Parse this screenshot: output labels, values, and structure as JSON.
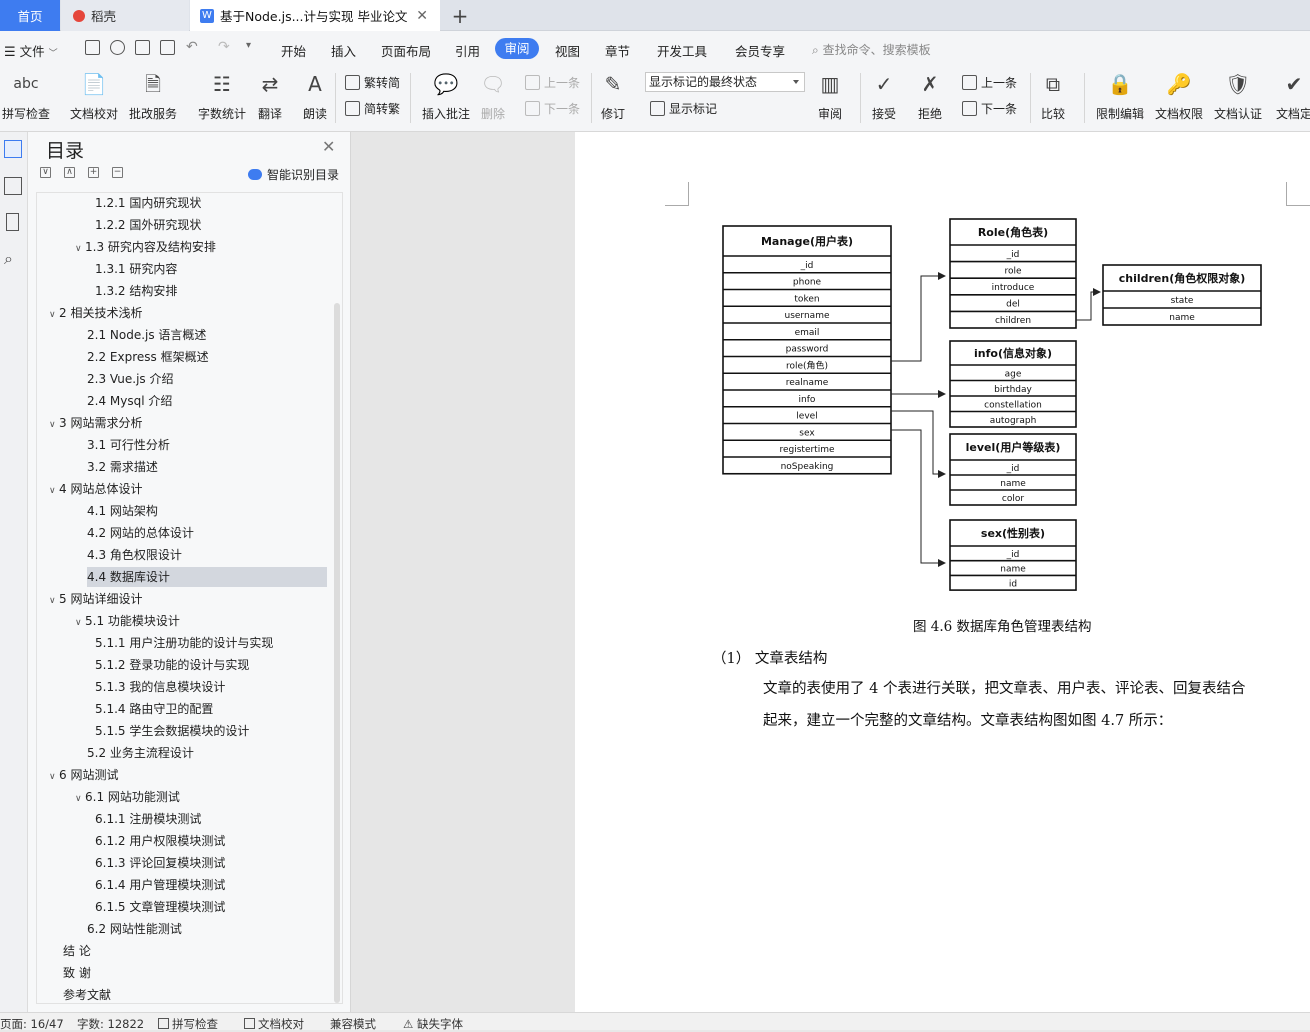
{
  "tabs": [
    {
      "label": "首页"
    },
    {
      "label": "稻壳"
    },
    {
      "label": "基于Node.js...计与实现 毕业论文"
    }
  ],
  "menu": {
    "file": "文件",
    "items": [
      "开始",
      "插入",
      "页面布局",
      "引用",
      "审阅",
      "视图",
      "章节",
      "开发工具",
      "会员专享"
    ],
    "active": "审阅",
    "search": "查找命令、搜索模板"
  },
  "ribbon": {
    "spell": "拼写检查",
    "doc_check": "文档校对",
    "review_service": "批改服务",
    "word_count": "字数统计",
    "translate": "翻译",
    "read_aloud": "朗读",
    "to_trad": "繁转简",
    "to_simp": "简转繁",
    "insert_comment": "插入批注",
    "delete": "删除",
    "prev_comment": "上一条",
    "next_comment": "下一条",
    "track": "修订",
    "mark_state": "显示标记的最终状态",
    "show_marks": "显示标记",
    "review": "审阅",
    "accept": "接受",
    "reject": "拒绝",
    "prev_change": "上一条",
    "next_change": "下一条",
    "compare": "比较",
    "restrict": "限制编辑",
    "permission": "文档权限",
    "certify": "文档认证",
    "finalize": "文档定"
  },
  "toc": {
    "title": "目录",
    "smart": "智能识别目录",
    "selected_index": 18,
    "items": [
      {
        "text": "1.2.1 国内研究现状",
        "level": 3
      },
      {
        "text": "1.2.2 国外研究现状",
        "level": 3
      },
      {
        "text": "1.3  研究内容及结构安排",
        "level": 2,
        "caret": true
      },
      {
        "text": "1.3.1  研究内容",
        "level": 3
      },
      {
        "text": "1.3.2  结构安排",
        "level": 3
      },
      {
        "text": "2 相关技术浅析",
        "level": 1,
        "caret": true
      },
      {
        "text": "2.1 Node.js 语言概述",
        "level": 2
      },
      {
        "text": "2.2 Express 框架概述",
        "level": 2
      },
      {
        "text": "2.3 Vue.js 介绍",
        "level": 2
      },
      {
        "text": "2.4 Mysql 介绍",
        "level": 2
      },
      {
        "text": "3 网站需求分析",
        "level": 1,
        "caret": true
      },
      {
        "text": "3.1 可行性分析",
        "level": 2
      },
      {
        "text": "3.2 需求描述",
        "level": 2
      },
      {
        "text": "4 网站总体设计",
        "level": 1,
        "caret": true
      },
      {
        "text": "4.1  网站架构",
        "level": 2
      },
      {
        "text": "4.2  网站的总体设计",
        "level": 2
      },
      {
        "text": "4.3  角色权限设计",
        "level": 2
      },
      {
        "text": "4.4  数据库设计",
        "level": 2
      },
      {
        "text": "5 网站详细设计",
        "level": 1,
        "caret": true
      },
      {
        "text": "5.1  功能模块设计",
        "level": 2,
        "caret": true
      },
      {
        "text": "5.1.1  用户注册功能的设计与实现",
        "level": 3
      },
      {
        "text": "5.1.2  登录功能的设计与实现",
        "level": 3
      },
      {
        "text": "5.1.3  我的信息模块设计",
        "level": 3
      },
      {
        "text": "5.1.4  路由守卫的配置",
        "level": 3
      },
      {
        "text": "5.1.5  学生会数据模块的设计",
        "level": 3
      },
      {
        "text": "5.2 业务主流程设计",
        "level": 2
      },
      {
        "text": "6 网站测试",
        "level": 1,
        "caret": true
      },
      {
        "text": "6.1  网站功能测试",
        "level": 2,
        "caret": true
      },
      {
        "text": "6.1.1  注册模块测试",
        "level": 3
      },
      {
        "text": "6.1.2  用户权限模块测试",
        "level": 3
      },
      {
        "text": "6.1.3  评论回复模块测试",
        "level": 3
      },
      {
        "text": "6.1.4  用户管理模块测试",
        "level": 3
      },
      {
        "text": "6.1.5  文章管理模块测试",
        "level": 3
      },
      {
        "text": "6.2  网站性能测试",
        "level": 2
      },
      {
        "text": "结    论",
        "level": 0
      },
      {
        "text": "致    谢",
        "level": 0
      },
      {
        "text": "参考文献",
        "level": 0
      }
    ]
  },
  "document": {
    "caption": "图 4.6 数据库角色管理表结构",
    "heading": "（1）  文章表结构",
    "para_line1": "文章的表使用了 4 个表进行关联，把文章表、用户表、评论表、回复表结合",
    "para_line2": "起来，建立一个完整的文章结构。文章表结构图如图 4.7 所示："
  },
  "diagram": {
    "tables": [
      {
        "title": "Manage(用户表)",
        "fields": [
          "_id",
          "phone",
          "token",
          "username",
          "email",
          "password",
          "role(角色)",
          "realname",
          "info",
          "level",
          "sex",
          "registertime",
          "noSpeaking"
        ]
      },
      {
        "title": "Role(角色表)",
        "fields": [
          "_id",
          "role",
          "introduce",
          "del",
          "children"
        ]
      },
      {
        "title": "children(角色权限对象)",
        "fields": [
          "state",
          "name"
        ]
      },
      {
        "title": "info(信息对象)",
        "fields": [
          "age",
          "birthday",
          "constellation",
          "autograph"
        ]
      },
      {
        "title": "level(用户等级表)",
        "fields": [
          "_id",
          "name",
          "color"
        ]
      },
      {
        "title": "sex(性别表)",
        "fields": [
          "_id",
          "name",
          "id"
        ]
      }
    ]
  },
  "status": {
    "page": "页面: 16/47",
    "words": "字数: 12822",
    "spell": "拼写检查",
    "check": "文档校对",
    "compat": "兼容模式",
    "missing_font": "缺失字体"
  },
  "colors": {
    "accent": "#3e7cf0"
  }
}
